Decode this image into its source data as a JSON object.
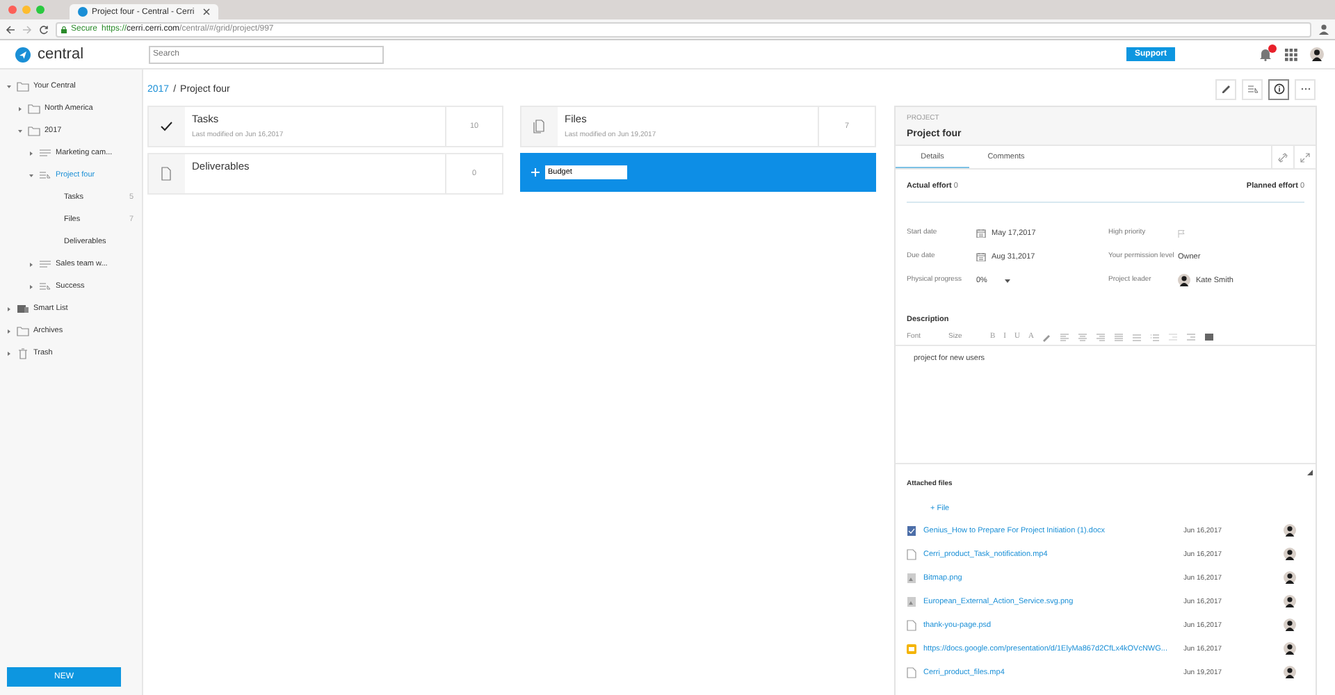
{
  "browser": {
    "tab_title": "Project four - Central - Cerri",
    "secure_label": "Secure",
    "url": {
      "scheme": "https://",
      "host": "cerri.cerri.com",
      "path": "/central/#/grid/project/997"
    }
  },
  "header": {
    "logo_text": "central",
    "search": {
      "placeholder": "Search"
    },
    "support_button": "Support",
    "notifications": {
      "unread": true
    }
  },
  "sidebar": {
    "items": [
      {
        "label": "Your Central",
        "kind": "folder",
        "expanded": true,
        "selected": false,
        "children": [
          {
            "label": "North America",
            "kind": "folder",
            "expanded": false,
            "selected": false
          },
          {
            "label": "2017",
            "kind": "folder",
            "expanded": true,
            "selected": false,
            "children": [
              {
                "label": "Marketing cam...",
                "kind": "list",
                "expanded": false,
                "selected": false
              },
              {
                "label": "Project four",
                "kind": "project",
                "expanded": true,
                "selected": true,
                "children": [
                  {
                    "label": "Tasks",
                    "count": "5",
                    "selected": false
                  },
                  {
                    "label": "Files",
                    "count": "7",
                    "selected": false
                  },
                  {
                    "label": "Deliverables",
                    "selected": false
                  }
                ]
              },
              {
                "label": "Sales team w...",
                "kind": "list",
                "expanded": false,
                "selected": false
              },
              {
                "label": "Success",
                "kind": "project",
                "expanded": false,
                "selected": false
              }
            ]
          }
        ]
      },
      {
        "label": "Smart List",
        "kind": "smartlist",
        "expanded": false,
        "selected": false
      },
      {
        "label": "Archives",
        "kind": "folder",
        "expanded": false,
        "selected": false
      },
      {
        "label": "Trash",
        "kind": "trash",
        "expanded": false,
        "selected": false
      }
    ],
    "new_button": "NEW"
  },
  "breadcrumb": {
    "parent": "2017",
    "separator": "/",
    "current": "Project four"
  },
  "view_buttons": [
    {
      "kind": "edit",
      "selected": false
    },
    {
      "kind": "list",
      "selected": false
    },
    {
      "kind": "info",
      "selected": true
    },
    {
      "kind": "more",
      "selected": false
    }
  ],
  "cards": [
    {
      "kind": "tasks",
      "title": "Tasks",
      "subtitle": "Last modified on Jun 16,2017",
      "count": "10"
    },
    {
      "kind": "files",
      "title": "Files",
      "subtitle": "Last modified on Jun 19,2017",
      "count": "7"
    },
    {
      "kind": "deliverables",
      "title": "Deliverables",
      "count": "0"
    },
    {
      "kind": "new",
      "value": "Budget"
    }
  ],
  "panel": {
    "overline": "PROJECT",
    "title": "Project four",
    "tabs": [
      {
        "label": "Details",
        "selected": true
      },
      {
        "label": "Comments",
        "selected": false
      }
    ],
    "actual_effort": {
      "label": "Actual effort",
      "value": "0"
    },
    "planned_effort": {
      "label": "Planned effort",
      "value": "0"
    },
    "fields": [
      {
        "label": "Start date",
        "kind": "date",
        "value": "May 17,2017"
      },
      {
        "label": "High priority",
        "kind": "flag",
        "on": false
      },
      {
        "label": "Due date",
        "kind": "date",
        "value": "Aug 31,2017"
      },
      {
        "label": "Your permission level",
        "kind": "text",
        "value": "Owner"
      },
      {
        "label": "Physical progress",
        "kind": "dropdown",
        "value": "0%"
      },
      {
        "label": "Project leader",
        "kind": "person",
        "value": "Kate Smith"
      }
    ],
    "description": {
      "label": "Description",
      "toolbar": [
        {
          "kind": "dropdown",
          "label": "Font"
        },
        {
          "kind": "dropdown",
          "label": "Size"
        },
        {
          "kind": "letter",
          "label": "B"
        },
        {
          "kind": "letter",
          "label": "I"
        },
        {
          "kind": "letter",
          "label": "U"
        },
        {
          "kind": "letter",
          "label": "A"
        }
      ],
      "text": "project for new users"
    },
    "attachments": {
      "label": "Attached files",
      "add_link": "+ File",
      "files": [
        {
          "kind": "doc",
          "name": "Genius_How to Prepare For Project Initiation (1).docx",
          "date": "Jun 16,2017"
        },
        {
          "kind": "file",
          "name": "Cerri_product_Task_notification.mp4",
          "date": "Jun 16,2017"
        },
        {
          "kind": "image",
          "name": "Bitmap.png",
          "date": "Jun 16,2017"
        },
        {
          "kind": "image",
          "name": "European_External_Action_Service.svg.png",
          "date": "Jun 16,2017"
        },
        {
          "kind": "file",
          "name": "thank-you-page.psd",
          "date": "Jun 16,2017"
        },
        {
          "kind": "slides",
          "name": "https://docs.google.com/presentation/d/1ElyMa867d2CfLx4kOVcNWG...",
          "date": "Jun 16,2017"
        },
        {
          "kind": "file",
          "name": "Cerri_product_files.mp4",
          "date": "Jun 19,2017"
        }
      ]
    }
  }
}
